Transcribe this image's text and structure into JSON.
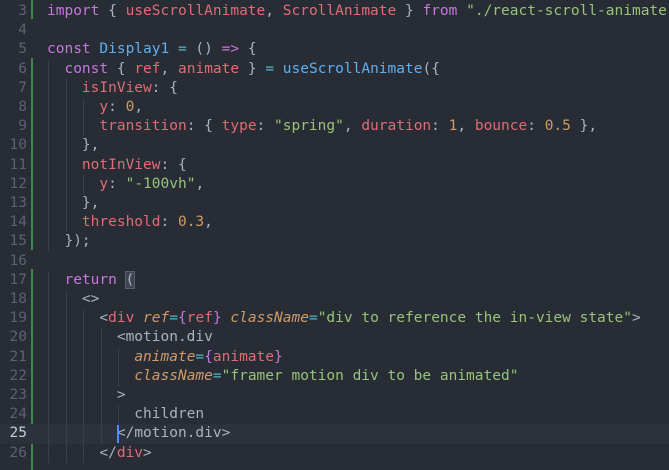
{
  "editor": {
    "current_line": 25,
    "lines": [
      {
        "num": "3",
        "segments": [
          {
            "t": "import",
            "c": "k"
          },
          {
            "t": " { ",
            "c": "p"
          },
          {
            "t": "useScrollAnimate",
            "c": "v"
          },
          {
            "t": ", ",
            "c": "p"
          },
          {
            "t": "ScrollAnimate",
            "c": "v"
          },
          {
            "t": " } ",
            "c": "p"
          },
          {
            "t": "from",
            "c": "k"
          },
          {
            "t": " ",
            "c": "p"
          },
          {
            "t": "\"./react-scroll-animate\"",
            "c": "s"
          },
          {
            "t": ";",
            "c": "p"
          }
        ]
      },
      {
        "num": "4",
        "segments": []
      },
      {
        "num": "5",
        "segments": [
          {
            "t": "const",
            "c": "k"
          },
          {
            "t": " ",
            "c": "p"
          },
          {
            "t": "Display1",
            "c": "f"
          },
          {
            "t": " ",
            "c": "p"
          },
          {
            "t": "=",
            "c": "o"
          },
          {
            "t": " () ",
            "c": "p"
          },
          {
            "t": "=>",
            "c": "k"
          },
          {
            "t": " {",
            "c": "p"
          }
        ]
      },
      {
        "num": "6",
        "segments": [
          {
            "t": "  ",
            "c": "p"
          },
          {
            "t": "const",
            "c": "k"
          },
          {
            "t": " { ",
            "c": "p"
          },
          {
            "t": "ref",
            "c": "v"
          },
          {
            "t": ", ",
            "c": "p"
          },
          {
            "t": "animate",
            "c": "v"
          },
          {
            "t": " } ",
            "c": "p"
          },
          {
            "t": "=",
            "c": "o"
          },
          {
            "t": " ",
            "c": "p"
          },
          {
            "t": "useScrollAnimate",
            "c": "f"
          },
          {
            "t": "({",
            "c": "p"
          }
        ]
      },
      {
        "num": "7",
        "segments": [
          {
            "t": "    ",
            "c": "p"
          },
          {
            "t": "isInView",
            "c": "v"
          },
          {
            "t": ": {",
            "c": "p"
          }
        ]
      },
      {
        "num": "8",
        "segments": [
          {
            "t": "      ",
            "c": "p"
          },
          {
            "t": "y",
            "c": "v"
          },
          {
            "t": ": ",
            "c": "p"
          },
          {
            "t": "0",
            "c": "n"
          },
          {
            "t": ",",
            "c": "p"
          }
        ]
      },
      {
        "num": "9",
        "segments": [
          {
            "t": "      ",
            "c": "p"
          },
          {
            "t": "transition",
            "c": "v"
          },
          {
            "t": ": { ",
            "c": "p"
          },
          {
            "t": "type",
            "c": "v"
          },
          {
            "t": ": ",
            "c": "p"
          },
          {
            "t": "\"spring\"",
            "c": "s"
          },
          {
            "t": ", ",
            "c": "p"
          },
          {
            "t": "duration",
            "c": "v"
          },
          {
            "t": ": ",
            "c": "p"
          },
          {
            "t": "1",
            "c": "n"
          },
          {
            "t": ", ",
            "c": "p"
          },
          {
            "t": "bounce",
            "c": "v"
          },
          {
            "t": ": ",
            "c": "p"
          },
          {
            "t": "0.5",
            "c": "n"
          },
          {
            "t": " },",
            "c": "p"
          }
        ]
      },
      {
        "num": "10",
        "segments": [
          {
            "t": "    },",
            "c": "p"
          }
        ]
      },
      {
        "num": "11",
        "segments": [
          {
            "t": "    ",
            "c": "p"
          },
          {
            "t": "notInView",
            "c": "v"
          },
          {
            "t": ": {",
            "c": "p"
          }
        ]
      },
      {
        "num": "12",
        "segments": [
          {
            "t": "      ",
            "c": "p"
          },
          {
            "t": "y",
            "c": "v"
          },
          {
            "t": ": ",
            "c": "p"
          },
          {
            "t": "\"-100vh\"",
            "c": "s"
          },
          {
            "t": ",",
            "c": "p"
          }
        ]
      },
      {
        "num": "13",
        "segments": [
          {
            "t": "    },",
            "c": "p"
          }
        ]
      },
      {
        "num": "14",
        "segments": [
          {
            "t": "    ",
            "c": "p"
          },
          {
            "t": "threshold",
            "c": "v"
          },
          {
            "t": ": ",
            "c": "p"
          },
          {
            "t": "0.3",
            "c": "n"
          },
          {
            "t": ",",
            "c": "p"
          }
        ]
      },
      {
        "num": "15",
        "segments": [
          {
            "t": "  });",
            "c": "p"
          }
        ]
      },
      {
        "num": "16",
        "segments": []
      },
      {
        "num": "17",
        "segments": [
          {
            "t": "  ",
            "c": "p"
          },
          {
            "t": "return",
            "c": "k"
          },
          {
            "t": " ",
            "c": "p"
          },
          {
            "t": "(",
            "c": "bm"
          }
        ]
      },
      {
        "num": "18",
        "segments": [
          {
            "t": "    ",
            "c": "p"
          },
          {
            "t": "<>",
            "c": "p"
          }
        ]
      },
      {
        "num": "19",
        "segments": [
          {
            "t": "      <",
            "c": "p"
          },
          {
            "t": "div",
            "c": "t"
          },
          {
            "t": " ",
            "c": "p"
          },
          {
            "t": "ref",
            "c": "a"
          },
          {
            "t": "=",
            "c": "o"
          },
          {
            "t": "{",
            "c": "k"
          },
          {
            "t": "ref",
            "c": "v"
          },
          {
            "t": "}",
            "c": "k"
          },
          {
            "t": " ",
            "c": "p"
          },
          {
            "t": "className",
            "c": "a"
          },
          {
            "t": "=",
            "c": "o"
          },
          {
            "t": "\"div to reference the in-view state\"",
            "c": "s"
          },
          {
            "t": ">",
            "c": "p"
          }
        ]
      },
      {
        "num": "20",
        "segments": [
          {
            "t": "        <",
            "c": "p"
          },
          {
            "t": "motion.div",
            "c": "c"
          }
        ]
      },
      {
        "num": "21",
        "segments": [
          {
            "t": "          ",
            "c": "p"
          },
          {
            "t": "animate",
            "c": "a"
          },
          {
            "t": "=",
            "c": "o"
          },
          {
            "t": "{",
            "c": "k"
          },
          {
            "t": "animate",
            "c": "v"
          },
          {
            "t": "}",
            "c": "k"
          }
        ]
      },
      {
        "num": "22",
        "segments": [
          {
            "t": "          ",
            "c": "p"
          },
          {
            "t": "className",
            "c": "a"
          },
          {
            "t": "=",
            "c": "o"
          },
          {
            "t": "\"framer motion div to be animated\"",
            "c": "s"
          }
        ]
      },
      {
        "num": "23",
        "segments": [
          {
            "t": "        >",
            "c": "p"
          }
        ]
      },
      {
        "num": "24",
        "segments": [
          {
            "t": "          children",
            "c": "p"
          }
        ]
      },
      {
        "num": "25",
        "segments": [
          {
            "t": "        </",
            "c": "p"
          },
          {
            "t": "motion.div",
            "c": "c"
          },
          {
            "t": ">",
            "c": "p"
          }
        ]
      },
      {
        "num": "26",
        "segments": [
          {
            "t": "      </",
            "c": "p"
          },
          {
            "t": "div",
            "c": "t"
          },
          {
            "t": ">",
            "c": "p"
          }
        ]
      }
    ]
  },
  "colors": {
    "background": "#272c35",
    "current_line": "#2c323c",
    "git_added": "#3b8a4f",
    "keyword": "#c678dd",
    "function": "#61afef",
    "variable": "#e06c75",
    "string": "#98c379",
    "number": "#d19a66"
  }
}
